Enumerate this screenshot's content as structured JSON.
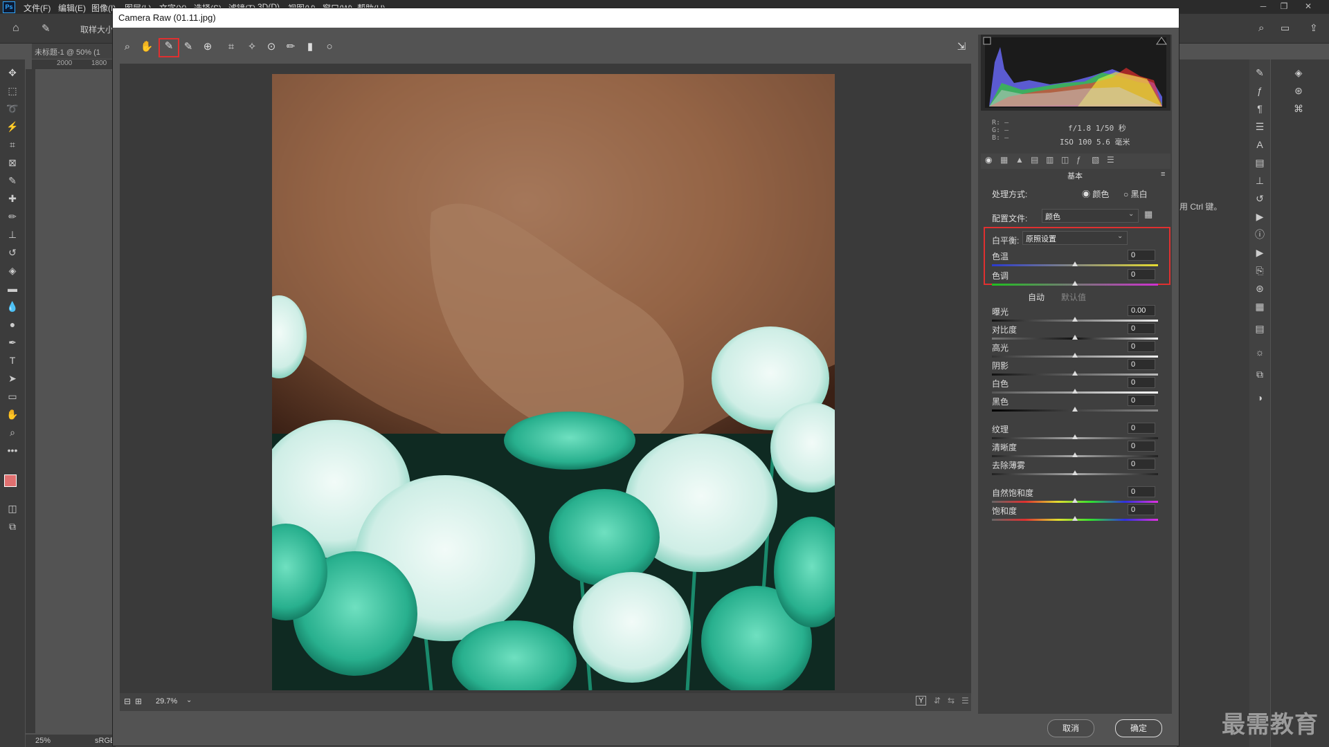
{
  "menubar": {
    "logo": "Ps",
    "items": [
      "文件(F)",
      "编辑(E)",
      "图像(I)",
      "图层(L)",
      "文字(Y)",
      "选择(S)",
      "滤镜(T)",
      "3D(D)",
      "视图(V)",
      "窗口(W)",
      "帮助(H)"
    ]
  },
  "optbar": {
    "sample_label": "取样大小"
  },
  "document": {
    "tab_label": "未标题-1 @ 50% (1",
    "ruler_marks": [
      "2000",
      "1800"
    ],
    "zoom": "25%",
    "color_profile": "sRGB"
  },
  "camera_raw": {
    "title": "Camera Raw (01.11.jpg)",
    "zoom_value": "29.7%",
    "histogram": {
      "rgb": [
        "R:",
        "G:",
        "B:"
      ],
      "rgb_values": [
        "—",
        "—",
        "—"
      ],
      "exif_line1": "f/1.8  1/50 秒",
      "exif_line2": "ISO 100  5.6 毫米"
    },
    "panel_title": "基本",
    "treatment": {
      "label": "处理方式:",
      "option_color": "颜色",
      "option_bw": "黑白"
    },
    "profile": {
      "label": "配置文件:",
      "value": "颜色"
    },
    "white_balance": {
      "label": "白平衡:",
      "value": "原照设置"
    },
    "auto_label": "自动",
    "default_label": "默认值",
    "sliders": [
      {
        "label": "色温",
        "value": "0"
      },
      {
        "label": "色调",
        "value": "0"
      },
      {
        "label": "曝光",
        "value": "0.00"
      },
      {
        "label": "对比度",
        "value": "0"
      },
      {
        "label": "高光",
        "value": "0"
      },
      {
        "label": "阴影",
        "value": "0"
      },
      {
        "label": "白色",
        "value": "0"
      },
      {
        "label": "黑色",
        "value": "0"
      },
      {
        "label": "纹理",
        "value": "0"
      },
      {
        "label": "清晰度",
        "value": "0"
      },
      {
        "label": "去除薄雾",
        "value": "0"
      },
      {
        "label": "自然饱和度",
        "value": "0"
      },
      {
        "label": "饱和度",
        "value": "0"
      }
    ],
    "cancel_label": "取消",
    "ok_label": "确定"
  },
  "right_panel": {
    "hint_text": "用 Ctrl 键。"
  },
  "watermark": "最需教育",
  "colors": {
    "highlight": "#e03030",
    "accent": "#31a8ff"
  }
}
